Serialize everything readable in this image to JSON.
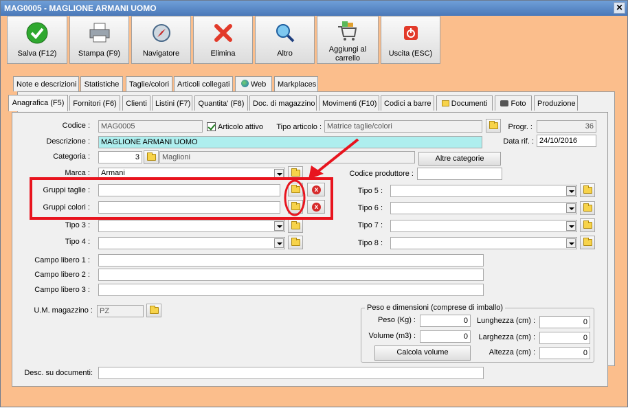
{
  "window": {
    "title": "MAG0005 - MAGLIONE ARMANI UOMO",
    "close": "✕"
  },
  "toolbar": {
    "salva": "Salva (F12)",
    "stampa": "Stampa (F9)",
    "navigatore": "Navigatore",
    "elimina": "Elimina",
    "altro": "Altro",
    "carrello": "Aggiungi al carrello",
    "uscita": "Uscita (ESC)"
  },
  "tabs_top": [
    "Note e descrizioni",
    "Statistiche",
    "Taglie/colori",
    "Articoli collegati",
    "Web",
    "Markplaces"
  ],
  "tabs_bottom": [
    "Anagrafica (F5)",
    "Fornitori (F6)",
    "Clienti",
    "Listini (F7)",
    "Quantita' (F8)",
    "Doc. di magazzino",
    "Movimenti (F10)",
    "Codici a barre",
    "Documenti",
    "Foto",
    "Produzione"
  ],
  "form": {
    "codice_label": "Codice :",
    "codice": "MAG0005",
    "articolo_attivo": "Articolo attivo",
    "tipo_articolo_label": "Tipo articolo :",
    "tipo_articolo": "Matrice taglie/colori",
    "progr_label": "Progr. :",
    "progr": "36",
    "descrizione_label": "Descrizione :",
    "descrizione": "MAGLIONE ARMANI UOMO",
    "data_rif_label": "Data rif. :",
    "data_rif": "24/10/2016",
    "categoria_label": "Categoria :",
    "categoria_num": "3",
    "categoria": "Maglioni",
    "altre_categorie": "Altre categorie",
    "marca_label": "Marca :",
    "marca": "Armani",
    "codice_produttore_label": "Codice produttore :",
    "codice_produttore": "",
    "gruppi_taglie_label": "Gruppi taglie :",
    "gruppi_colori_label": "Gruppi colori :",
    "tipo3_label": "Tipo 3 :",
    "tipo4_label": "Tipo 4 :",
    "tipo5_label": "Tipo 5 :",
    "tipo6_label": "Tipo 6 :",
    "tipo7_label": "Tipo 7 :",
    "tipo8_label": "Tipo 8 :",
    "campo1_label": "Campo libero 1 :",
    "campo2_label": "Campo libero 2 :",
    "campo3_label": "Campo libero 3 :",
    "um_label": "U.M. magazzino :",
    "um": "PZ",
    "desc_doc_label": "Desc. su documenti:"
  },
  "peso": {
    "title": "Peso e dimensioni (comprese di imballo)",
    "peso_label": "Peso (Kg) :",
    "peso": "0",
    "volume_label": "Volume (m3) :",
    "volume": "0",
    "calcola": "Calcola volume",
    "lunghezza_label": "Lunghezza (cm) :",
    "lunghezza": "0",
    "larghezza_label": "Larghezza (cm) :",
    "larghezza": "0",
    "altezza_label": "Altezza (cm) :",
    "altezza": "0"
  },
  "colors": {
    "highlight": "#e8141e",
    "cyan_field": "#aeeeee",
    "background": "#fbbe8c"
  }
}
